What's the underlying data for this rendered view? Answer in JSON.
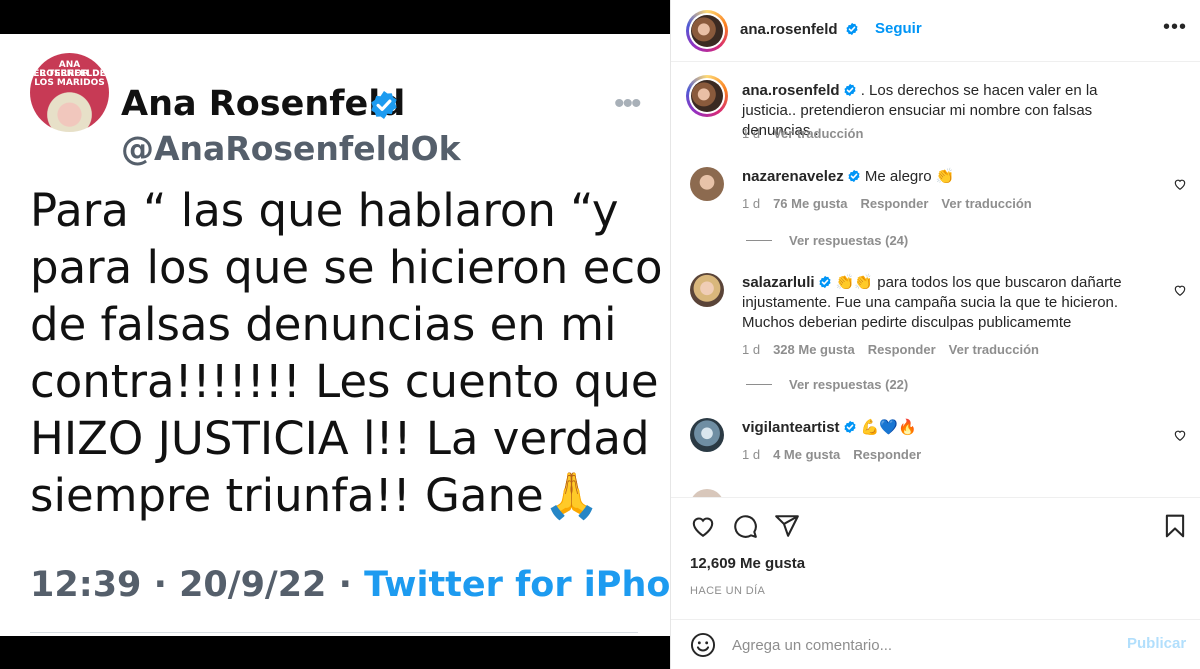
{
  "tweet": {
    "avatar_text_1": "ANA ROSENFELD",
    "avatar_text_2": "EL TERROR DE LOS MARIDOS",
    "name": "Ana Rosenfeld",
    "handle": "@AnaRosenfeldOk",
    "more": "•••",
    "lines": [
      "Para “ las  que hablaron “y",
      "para los  que se hicieron eco",
      "de falsas denuncias en mi",
      "contra!!!!!!! Les cuento que SE",
      "HIZO JUSTICIA l!! La verdad",
      "siempre triunfa!! Gane🙏"
    ],
    "meta_time": "12:39 · 20/9/22 · ",
    "meta_app": "Twitter for iPhone"
  },
  "instagram": {
    "header": {
      "username": "ana.rosenfeld",
      "follow": "Seguir",
      "more": "•••"
    },
    "caption": {
      "username": "ana.rosenfeld",
      "text": " . Los derechos se hacen valer en la justicia.. pretendieron ensuciar mi nombre con falsas denuncias .",
      "time": "1 d",
      "translate": "Ver traducción"
    },
    "comments": [
      {
        "username": "nazarenavelez",
        "text": " Me alegro 👏",
        "time": "1 d",
        "likes": "76 Me gusta",
        "reply": "Responder",
        "translate": "Ver traducción",
        "replies": "Ver respuestas (24)"
      },
      {
        "username": "salazarluli",
        "text": " 👏👏 para todos los que buscaron dañarte injustamente. Fue una campaña sucia la que te hicieron. Muchos deberian pedirte disculpas publicamemte",
        "time": "1 d",
        "likes": "328 Me gusta",
        "reply": "Responder",
        "translate": "Ver traducción",
        "replies": "Ver respuestas (22)"
      },
      {
        "username": "vigilanteartist",
        "text": " 💪💙🔥",
        "time": "1 d",
        "likes": "4 Me gusta",
        "reply": "Responder"
      }
    ],
    "likes": "12,609 Me gusta",
    "posted": "HACE UN DÍA",
    "comment_placeholder": "Agrega un comentario...",
    "publish": "Publicar",
    "colors": {
      "link": "#0095f6",
      "verified": "#0095f6",
      "muted": "#8e8e8e",
      "twitter_blue": "#1d9bf0"
    }
  }
}
